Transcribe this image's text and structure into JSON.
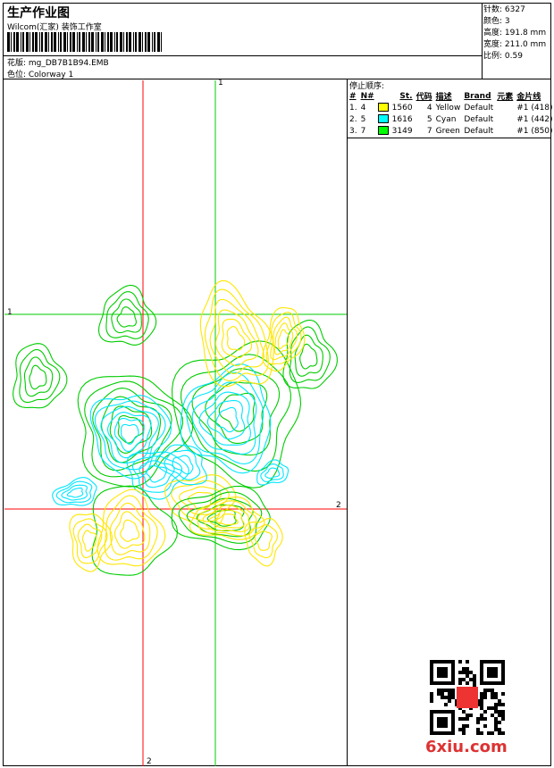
{
  "header": {
    "title": "生产作业图",
    "studio": "Wilcom(汇家) 装饰工作室",
    "design_label": "花版: mg_DB7B1B94.EMB",
    "colorway_label": "色位: Colorway 1"
  },
  "stats": [
    {
      "label": "针数",
      "value": "6327"
    },
    {
      "label": "颜色",
      "value": "3"
    },
    {
      "label": "高度",
      "value": "191.8 mm"
    },
    {
      "label": "宽度",
      "value": "211.0 mm"
    },
    {
      "label": "比例",
      "value": "0.59"
    }
  ],
  "stop_sequence": {
    "title": "停止顺序:",
    "columns": [
      "#",
      "N#",
      "St.",
      "代码",
      "描述",
      "Brand",
      "元素",
      "金片线"
    ],
    "rows": [
      {
        "seq": "1.",
        "needle": "4",
        "color": "#ffff00",
        "stitches": "1560",
        "code": "4",
        "desc": "Yellow",
        "brand": "Default",
        "element": "#1 (418)"
      },
      {
        "seq": "2.",
        "needle": "5",
        "color": "#00ffff",
        "stitches": "1616",
        "code": "5",
        "desc": "Cyan",
        "brand": "Default",
        "element": "#1 (442)"
      },
      {
        "seq": "3.",
        "needle": "7",
        "color": "#00ff00",
        "stitches": "3149",
        "code": "7",
        "desc": "Green",
        "brand": "Default",
        "element": "#1 (850)"
      }
    ]
  },
  "axes": {
    "green_v": "1",
    "green_h": "1",
    "red_h": "2",
    "red_v": "2"
  },
  "watermark": "6xiu.com",
  "colors": {
    "red": "#ff0000",
    "green": "#00cc00",
    "yellow": "#ffe600",
    "cyan": "#00e5ff"
  }
}
